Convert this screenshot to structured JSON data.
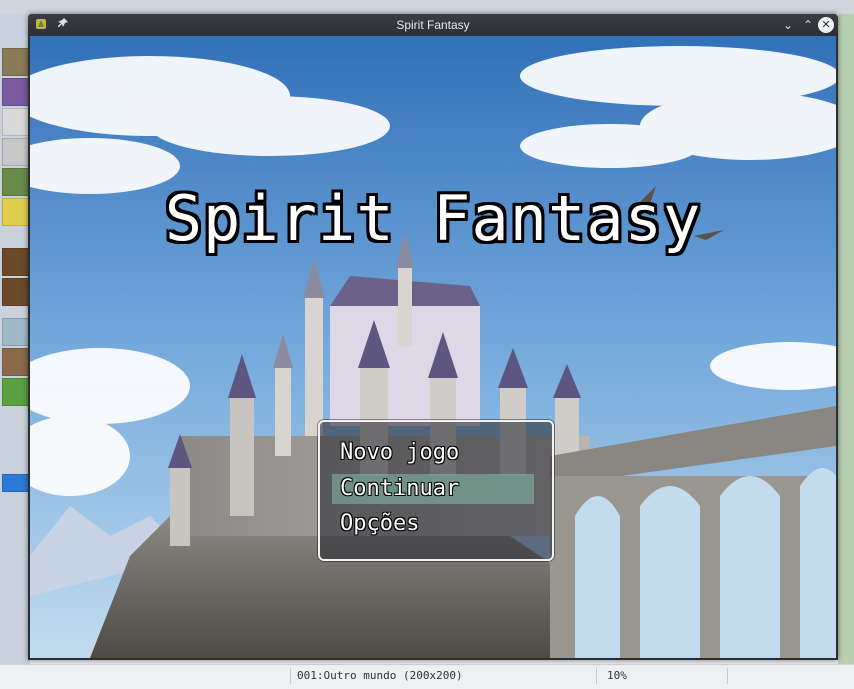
{
  "window": {
    "title": "Spirit Fantasy",
    "app_icon": "rpgmaker-app-icon",
    "pin_icon": "pin-icon",
    "minimize_glyph": "⌄",
    "maximize_glyph": "⌃",
    "close_glyph": "✕"
  },
  "game": {
    "title": "Spirit Fantasy"
  },
  "menu": {
    "items": [
      "Novo jogo",
      "Continuar",
      "Opções"
    ],
    "selected_index": 1
  },
  "statusbar": {
    "map": "001:Outro mundo (200x200)",
    "zoom": "10%"
  },
  "colors": {
    "window_chrome": "#2c3035",
    "menu_border": "#f2f2f2",
    "menu_highlight": "#82beaa"
  }
}
